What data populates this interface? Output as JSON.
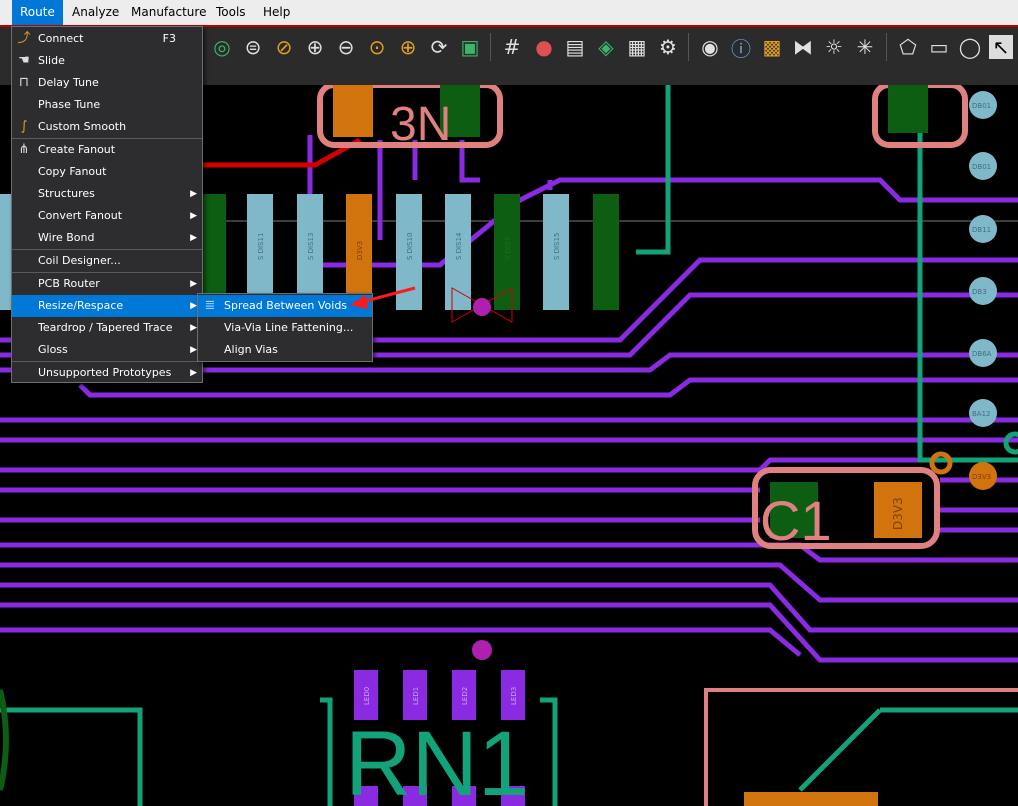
{
  "menubar": {
    "items": [
      "Route",
      "Analyze",
      "Manufacture",
      "Tools",
      "Help"
    ],
    "active": "Route"
  },
  "toolbar": {
    "icons": [
      "globe-icon",
      "zoom-selection-icon",
      "zoom-area-icon",
      "zoom-in-icon",
      "zoom-out-icon",
      "zoom-previous-icon",
      "zoom-fit-icon",
      "redraw-icon",
      "layer-bitmap-icon",
      "grid-icon",
      "color-wheel-icon",
      "shadow-mode-icon",
      "layers-stack-icon",
      "spreadsheet-icon",
      "settings-doc-icon",
      "visibility-eye-icon",
      "property-info-icon",
      "3d-view-icon",
      "flip-icon",
      "brightness-icon",
      "highlight-icon",
      "add-shape-icon",
      "add-rect-icon",
      "add-circle-icon",
      "select-icon"
    ]
  },
  "route_menu": {
    "items": [
      {
        "label": "Connect",
        "shortcut": "F3",
        "icon": "connect-icon",
        "submenu": false
      },
      {
        "label": "Slide",
        "icon": "slide-icon",
        "submenu": false
      },
      {
        "label": "Delay Tune",
        "icon": "delay-tune-icon",
        "submenu": false
      },
      {
        "label": "Phase Tune",
        "submenu": false
      },
      {
        "label": "Custom Smooth",
        "icon": "custom-smooth-icon",
        "submenu": false
      },
      {
        "label": "Create Fanout",
        "icon": "fanout-icon",
        "submenu": false
      },
      {
        "label": "Copy Fanout",
        "submenu": false
      },
      {
        "label": "Structures",
        "submenu": true
      },
      {
        "label": "Convert Fanout",
        "submenu": true
      },
      {
        "label": "Wire Bond",
        "submenu": true
      },
      {
        "label": "Coil Designer...",
        "submenu": false
      },
      {
        "label": "PCB Router",
        "submenu": true
      },
      {
        "label": "Resize/Respace",
        "submenu": true,
        "highlighted": true
      },
      {
        "label": "Teardrop / Tapered Trace",
        "submenu": true
      },
      {
        "label": "Gloss",
        "submenu": true
      },
      {
        "label": "Unsupported Prototypes",
        "submenu": true
      }
    ]
  },
  "resize_submenu": {
    "items": [
      {
        "label": "Spread Between Voids",
        "icon": "spread-voids-icon"
      },
      {
        "label": "Via-Via Line Fattening..."
      },
      {
        "label": "Align Vias"
      }
    ]
  },
  "pcb": {
    "refdes": [
      "RN1",
      "3N",
      "C1",
      "C1"
    ],
    "pad_labels": [
      "D3V3",
      "S DIS11",
      "S DIS13",
      "D3V3",
      "S DIS10",
      "S DIS14",
      "S DIS7",
      "S DIS15"
    ],
    "rn1_pad_labels": [
      "LED0",
      "LED1",
      "LED2",
      "LED3"
    ],
    "via_labels": [
      "DB01",
      "DB01",
      "DB11",
      "DB3",
      "DB6A",
      "BA12",
      "D3V3"
    ],
    "c1_pad_label": "D3V3"
  },
  "colors": {
    "trace_purple": "#8a2be2",
    "trace_green": "#12a37a",
    "trace_red": "#d40000",
    "pad_lightblue": "#7fb9c9",
    "pad_orange": "#d2740e",
    "pad_darkgreen": "#0d5d12",
    "silk_pink": "#e08080",
    "menu_highlight": "#0078d7"
  }
}
